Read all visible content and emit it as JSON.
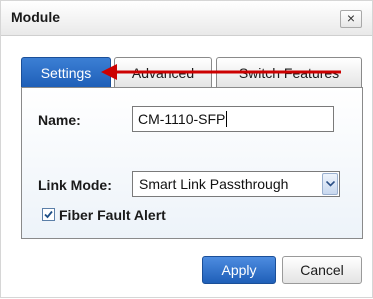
{
  "dialog": {
    "title": "Module",
    "close_label": "×"
  },
  "tabs": [
    {
      "label": "Settings",
      "active": true
    },
    {
      "label": "Advanced",
      "active": false
    },
    {
      "label": "Switch Features",
      "active": false
    }
  ],
  "form": {
    "name_label": "Name:",
    "name_value": "CM-1110-SFP",
    "link_mode_label": "Link Mode:",
    "link_mode_value": "Smart Link Passthrough",
    "fiber_fault_label": "Fiber Fault Alert",
    "fiber_fault_checked": true
  },
  "buttons": {
    "apply_label": "Apply",
    "cancel_label": "Cancel"
  },
  "annotation": {
    "arrow_color": "#cc0000"
  },
  "colors": {
    "accent_blue": "#2a6ac6"
  }
}
